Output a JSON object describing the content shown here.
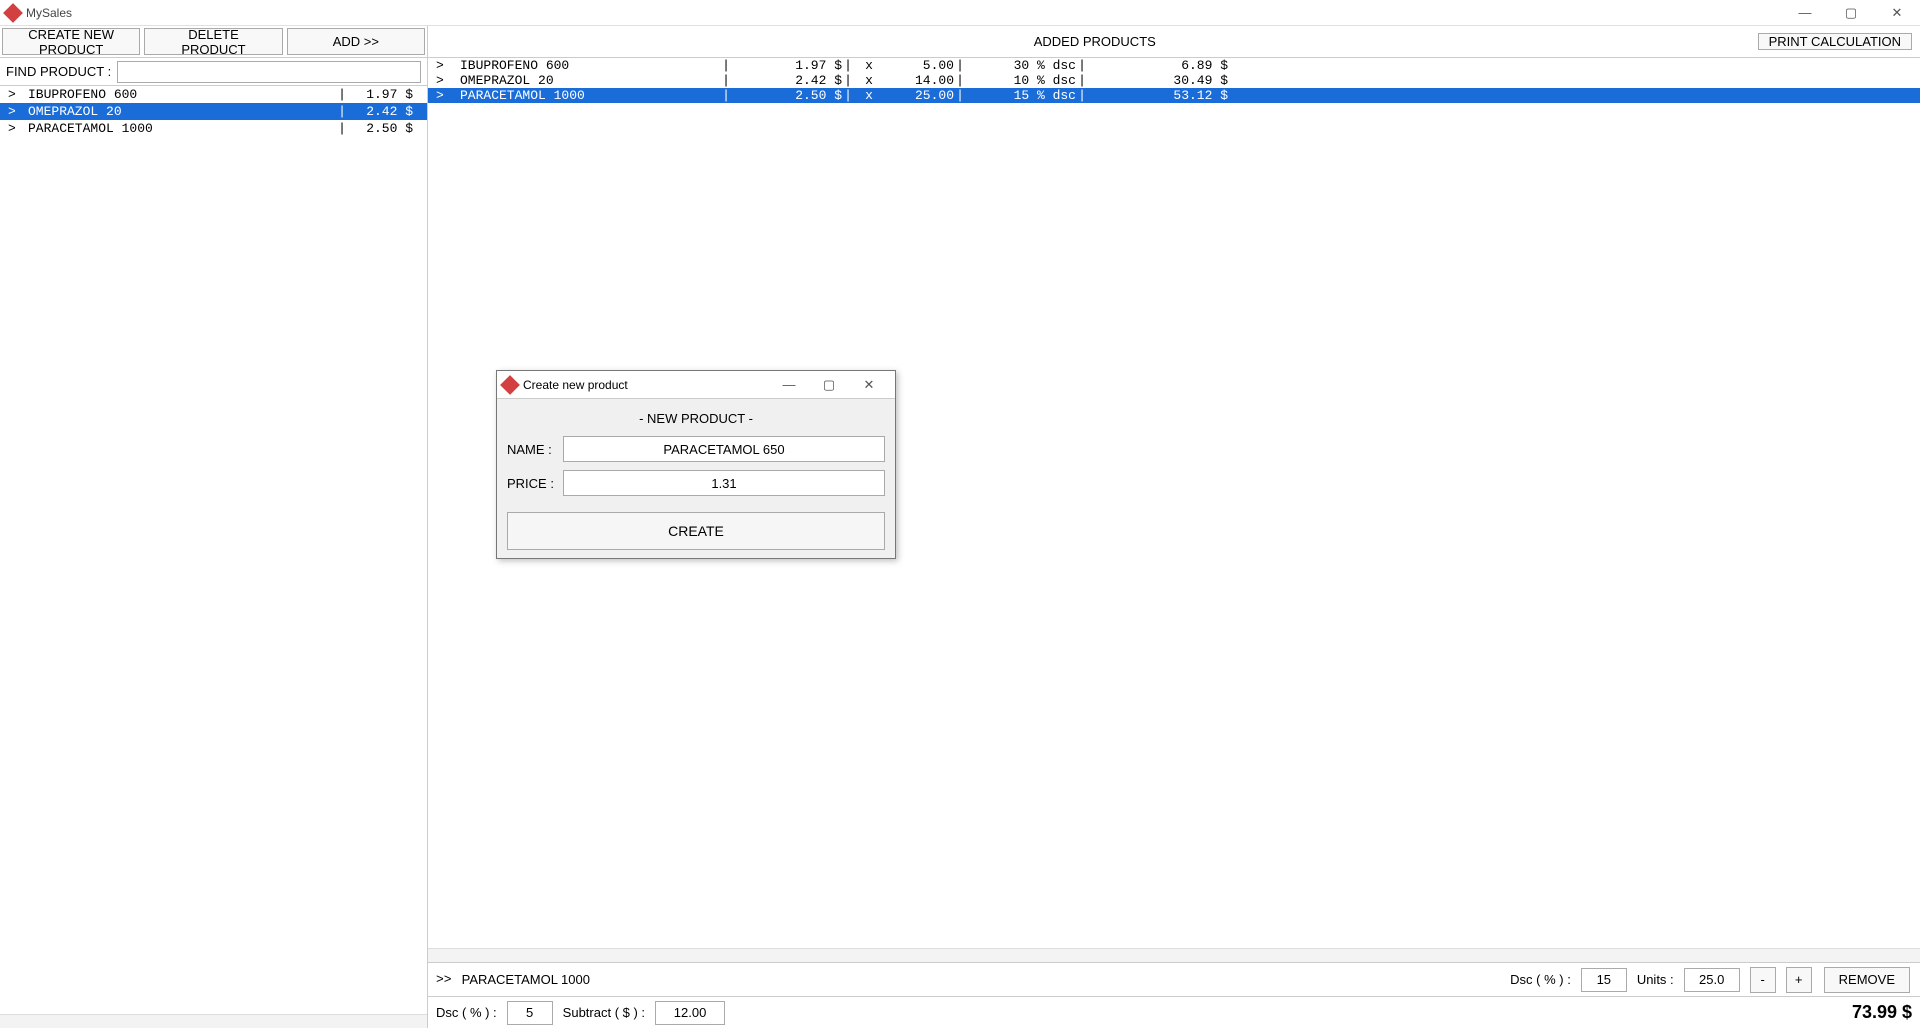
{
  "window": {
    "title": "MySales",
    "minimize_glyph": "—",
    "maximize_glyph": "▢",
    "close_glyph": "✕"
  },
  "toolbar": {
    "create_label": "CREATE NEW PRODUCT",
    "delete_label": "DELETE PRODUCT",
    "add_label": "ADD   >>",
    "print_label": "PRINT CALCULATION",
    "added_heading": "ADDED PRODUCTS"
  },
  "find": {
    "label": "FIND PRODUCT :",
    "value": ""
  },
  "product_list": [
    {
      "name": "IBUPROFENO 600",
      "price": "1.97 $",
      "selected": false
    },
    {
      "name": "OMEPRAZOL 20",
      "price": "2.42 $",
      "selected": true
    },
    {
      "name": "PARACETAMOL 1000",
      "price": "2.50 $",
      "selected": false
    }
  ],
  "added_list": [
    {
      "name": "IBUPROFENO 600",
      "price": "1.97 $",
      "qty": "5.00",
      "disc": "30 % dsc",
      "total": "6.89 $",
      "selected": false
    },
    {
      "name": "OMEPRAZOL 20",
      "price": "2.42 $",
      "qty": "14.00",
      "disc": "10 % dsc",
      "total": "30.49 $",
      "selected": false
    },
    {
      "name": "PARACETAMOL 1000",
      "price": "2.50 $",
      "qty": "25.00",
      "disc": "15 % dsc",
      "total": "53.12 $",
      "selected": true
    }
  ],
  "selected_bar": {
    "chevrons": ">>",
    "name": "PARACETAMOL 1000",
    "dsc_label": "Dsc ( % ) :",
    "dsc_value": "15",
    "units_label": "Units :",
    "units_value": "25.0",
    "minus": "-",
    "plus": "+",
    "remove_label": "REMOVE"
  },
  "totals_bar": {
    "dsc_label": "Dsc ( % ) :",
    "dsc_value": "5",
    "subtract_label": "Subtract ( $ ) :",
    "subtract_value": "12.00",
    "total": "73.99 $"
  },
  "dialog": {
    "title": "Create new product",
    "heading": "- NEW PRODUCT -",
    "name_label": "NAME :",
    "name_value": "PARACETAMOL 650",
    "price_label": "PRICE :",
    "price_value": "1.31",
    "create_label": "CREATE",
    "minimize_glyph": "—",
    "maximize_glyph": "▢",
    "close_glyph": "✕"
  },
  "glyphs": {
    "chevron": ">",
    "pipe": "|",
    "x": "x"
  }
}
